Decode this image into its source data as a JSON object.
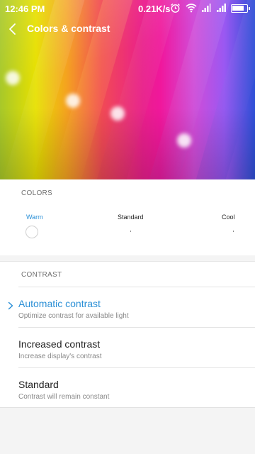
{
  "status_bar": {
    "time": "12:46 PM",
    "network_speed": "0.21K/s",
    "icons": [
      "alarm-icon",
      "wifi-icon",
      "signal-icon",
      "signal-icon",
      "battery-icon"
    ]
  },
  "header": {
    "title": "Colors & contrast",
    "back_icon": "back-arrow-icon"
  },
  "colors_section": {
    "label": "COLORS",
    "options": [
      "Warm",
      "Standard",
      "Cool"
    ],
    "selected": "Warm",
    "accent": "#2a8fd6"
  },
  "contrast_section": {
    "label": "CONTRAST",
    "options": [
      {
        "title": "Automatic contrast",
        "subtitle": "Optimize contrast for available light",
        "selected": true
      },
      {
        "title": "Increased contrast",
        "subtitle": "Increase display's contrast",
        "selected": false
      },
      {
        "title": "Standard",
        "subtitle": "Contrast will remain constant",
        "selected": false
      }
    ]
  }
}
